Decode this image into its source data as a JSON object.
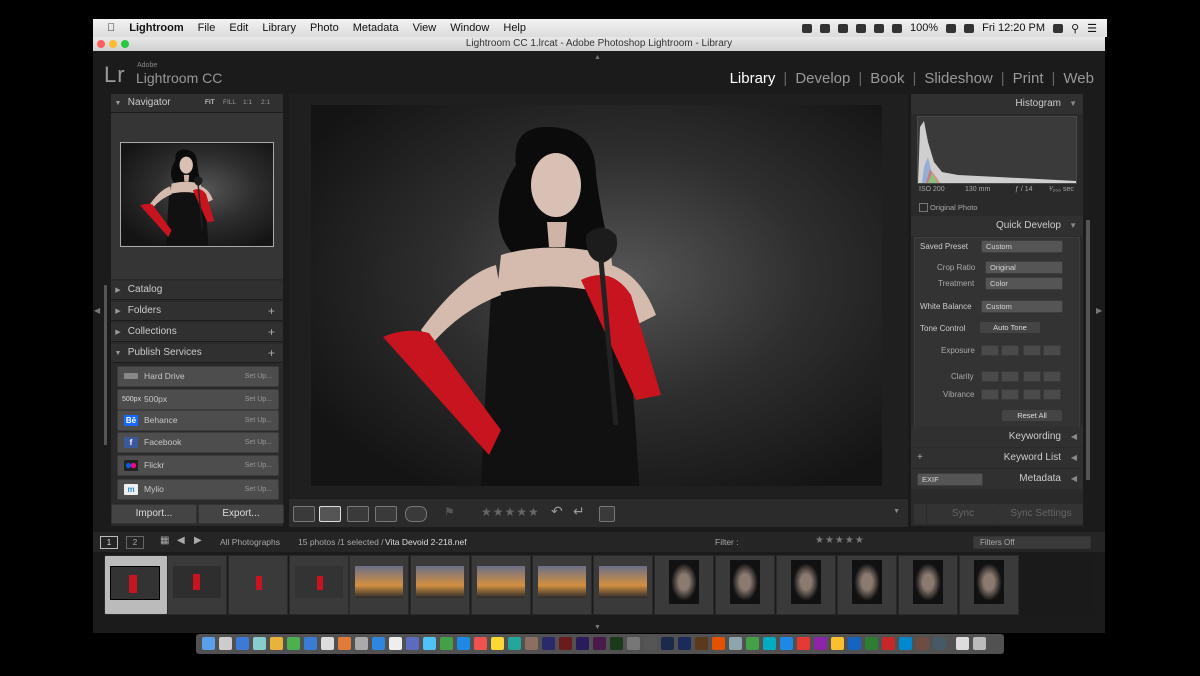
{
  "menubar": {
    "apple_icon": "apple-logo",
    "app_name": "Lightroom",
    "items": [
      "File",
      "Edit",
      "Library",
      "Photo",
      "Metadata",
      "View",
      "Window",
      "Help"
    ],
    "battery": "100%",
    "clock": "Fri 12:20 PM"
  },
  "window": {
    "title": "Lightroom CC 1.lrcat - Adobe Photoshop Lightroom - Library"
  },
  "brand": {
    "adobe": "Adobe",
    "lr": "Lr",
    "product": "Lightroom CC"
  },
  "modules": [
    "Library",
    "Develop",
    "Book",
    "Slideshow",
    "Print",
    "Web"
  ],
  "left": {
    "navigator": {
      "title": "Navigator",
      "zooms": [
        "FIT",
        "FILL",
        "1:1",
        "2:1"
      ]
    },
    "catalog": "Catalog",
    "folders": "Folders",
    "collections": "Collections",
    "publish": "Publish Services",
    "services": [
      {
        "name": "Hard Drive",
        "setup": "Set Up..."
      },
      {
        "name": "500px",
        "icon": "500px",
        "setup": "Set Up..."
      },
      {
        "name": "Behance",
        "icon": "Bē",
        "setup": "Set Up..."
      },
      {
        "name": "Facebook",
        "icon": "f",
        "setup": "Set Up..."
      },
      {
        "name": "Flickr",
        "setup": "Set Up..."
      },
      {
        "name": "Mylio",
        "icon": "m",
        "setup": "Set Up..."
      }
    ],
    "import": "Import...",
    "export": "Export..."
  },
  "right": {
    "histogram": "Histogram",
    "exif": {
      "iso": "ISO 200",
      "focal": "130 mm",
      "aperture": "ƒ / 14",
      "shutter": "¹⁄₂₀₀ sec"
    },
    "original_photo": "Original Photo",
    "quick_develop": "Quick Develop",
    "saved_preset": {
      "label": "Saved Preset",
      "value": "Custom"
    },
    "crop_ratio": {
      "label": "Crop Ratio",
      "value": "Original"
    },
    "treatment": {
      "label": "Treatment",
      "value": "Color"
    },
    "white_balance": {
      "label": "White Balance",
      "value": "Custom"
    },
    "tone_control": {
      "label": "Tone Control",
      "button": "Auto Tone"
    },
    "exposure": "Exposure",
    "clarity": "Clarity",
    "vibrance": "Vibrance",
    "reset": "Reset All",
    "keywording": "Keywording",
    "keyword_list": "Keyword List",
    "metadata": "Metadata",
    "metadata_preset": "EXIF",
    "sync": "Sync",
    "sync_settings": "Sync Settings"
  },
  "filmbar": {
    "pages": [
      "1",
      "2"
    ],
    "source": "All Photographs",
    "count": "15 photos /1 selected /",
    "filename": "Vita Devoid 2-218.nef",
    "filter_label": "Filter :",
    "filter_value": "Filters Off"
  },
  "colors": {
    "glove": "#c8141e",
    "active_module": "#ffffff",
    "panel": "#2a2a2a"
  }
}
